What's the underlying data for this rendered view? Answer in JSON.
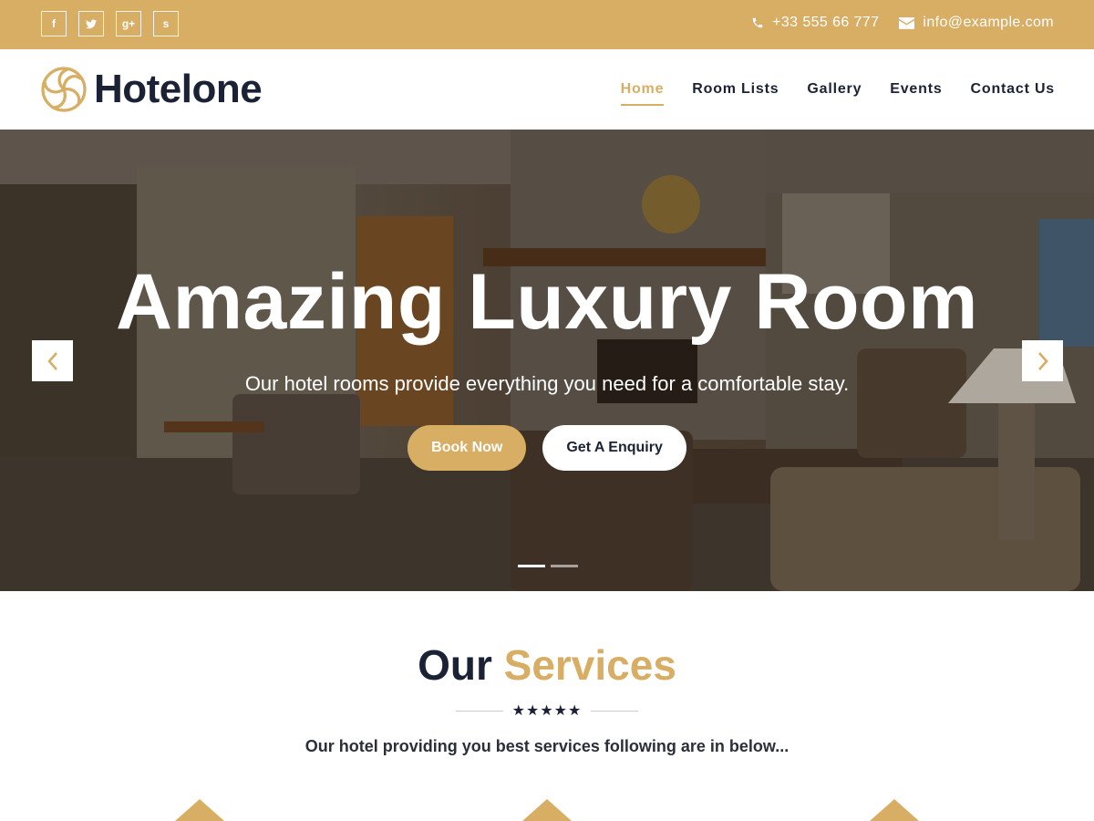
{
  "topbar": {
    "social": [
      {
        "icon": "facebook-icon",
        "glyph": "f"
      },
      {
        "icon": "twitter-icon",
        "glyph": "t"
      },
      {
        "icon": "google-plus-icon",
        "glyph": "g+"
      },
      {
        "icon": "stumbleupon-icon",
        "glyph": "s"
      }
    ],
    "phone": "+33 555 66 777",
    "email": "info@example.com"
  },
  "header": {
    "logo_text": "Hotelone",
    "nav": [
      "Home",
      "Room Lists",
      "Gallery",
      "Events",
      "Contact Us"
    ],
    "active_nav": "Home"
  },
  "hero": {
    "title": "Amazing Luxury Room",
    "subtitle": "Our hotel rooms provide everything you need for a comfortable stay.",
    "primary_button": "Book Now",
    "secondary_button": "Get A Enquiry",
    "slide_count": 2,
    "active_slide": 1
  },
  "services": {
    "title_part1": "Our",
    "title_part2": "Services",
    "stars": "★★★★★",
    "subtitle": "Our hotel providing you best services following are in below..."
  },
  "colors": {
    "accent": "#d8ad64",
    "dark": "#1b2235"
  }
}
